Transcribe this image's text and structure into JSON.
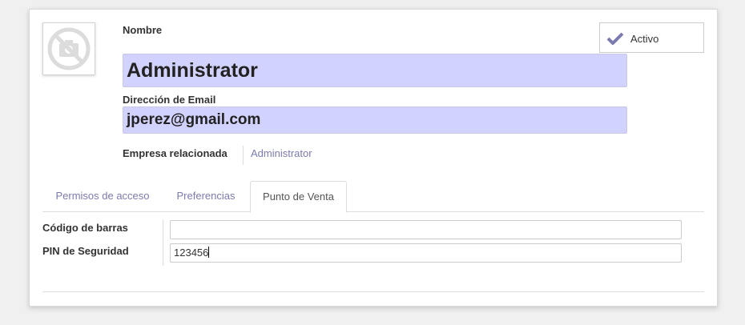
{
  "form": {
    "name_label": "Nombre",
    "name_value": "Administrator",
    "email_label": "Dirección de Email",
    "email_value": "jperez@gmail.com",
    "company_label": "Empresa relacionada",
    "company_value": "Administrator"
  },
  "status": {
    "label": "Activo",
    "icon": "check-icon",
    "checked": true
  },
  "avatar": {
    "icon": "no-camera-icon"
  },
  "tabs": [
    {
      "label": "Permisos de acceso",
      "active": false
    },
    {
      "label": "Preferencias",
      "active": false
    },
    {
      "label": "Punto de Venta",
      "active": true
    }
  ],
  "pos": {
    "barcode_label": "Código de barras",
    "barcode_value": "",
    "pin_label": "PIN de Seguridad",
    "pin_value": "123456"
  },
  "colors": {
    "input_highlight": "#d2d2ff",
    "link": "#7c7bad",
    "check": "#7c7bad"
  }
}
